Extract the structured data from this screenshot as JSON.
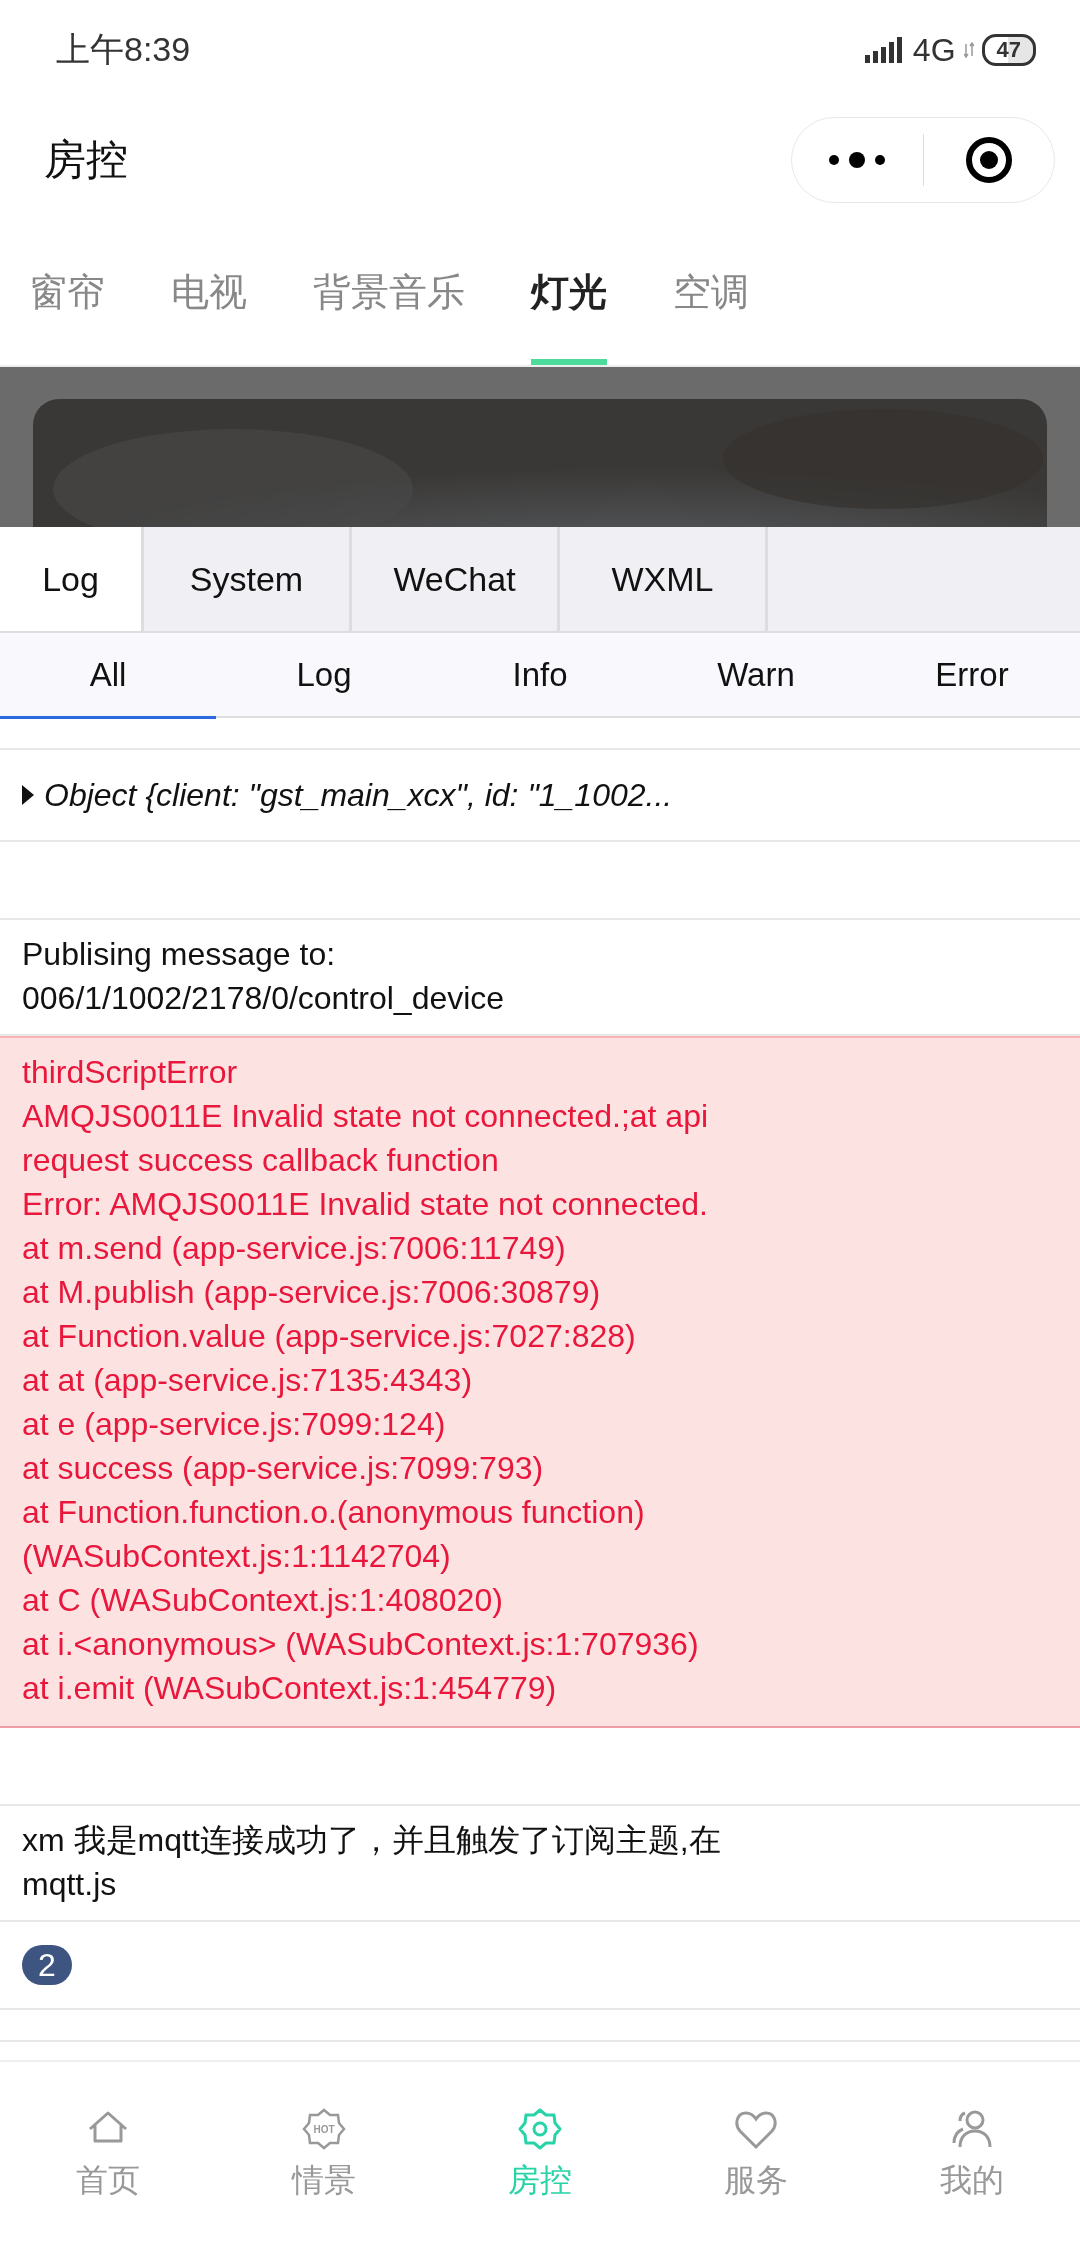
{
  "status_bar": {
    "time": "上午8:39",
    "network": "4G",
    "battery": "47"
  },
  "header": {
    "title": "房控"
  },
  "tabs": [
    {
      "label": "窗帘",
      "selected": false
    },
    {
      "label": "电视",
      "selected": false
    },
    {
      "label": "背景音乐",
      "selected": false
    },
    {
      "label": "灯光",
      "selected": true
    },
    {
      "label": "空调",
      "selected": false
    }
  ],
  "console": {
    "tabs": [
      {
        "label": "Log",
        "selected": true
      },
      {
        "label": "System",
        "selected": false
      },
      {
        "label": "WeChat",
        "selected": false
      },
      {
        "label": "WXML",
        "selected": false
      }
    ],
    "filters": [
      {
        "label": "All",
        "selected": true
      },
      {
        "label": "Log",
        "selected": false
      },
      {
        "label": "Info",
        "selected": false
      },
      {
        "label": "Warn",
        "selected": false
      },
      {
        "label": "Error",
        "selected": false
      }
    ],
    "entries": [
      {
        "kind": "cut"
      },
      {
        "kind": "object",
        "text": "Object {client: \"gst_main_xcx\", id: \"1_1002..."
      },
      {
        "kind": "empty"
      },
      {
        "kind": "log",
        "lines": [
          "Publising message to:",
          "006/1/1002/2178/0/control_device"
        ]
      },
      {
        "kind": "error",
        "lines": [
          "thirdScriptError",
          "AMQJS0011E Invalid state not connected.;at api",
          "request success callback function",
          "Error: AMQJS0011E Invalid state not connected.",
          "at m.send (app-service.js:7006:11749)",
          "at M.publish (app-service.js:7006:30879)",
          "at Function.value (app-service.js:7027:828)",
          "at at (app-service.js:7135:4343)",
          "at e (app-service.js:7099:124)",
          "at success (app-service.js:7099:793)",
          "at Function.function.o.(anonymous function)",
          "(WASubContext.js:1:1142704)",
          "at C (WASubContext.js:1:408020)",
          "at i.<anonymous> (WASubContext.js:1:707936)",
          "at i.emit (WASubContext.js:1:454779)"
        ]
      },
      {
        "kind": "empty"
      },
      {
        "kind": "log",
        "lines": [
          "xm 我是mqtt连接成功了，并且触发了订阅主题,在",
          "mqtt.js"
        ]
      },
      {
        "kind": "count",
        "text": "2"
      },
      {
        "kind": "cut"
      }
    ]
  },
  "nav": [
    {
      "label": "首页",
      "selected": false
    },
    {
      "label": "情景",
      "selected": false,
      "icon_text": "HOT"
    },
    {
      "label": "房控",
      "selected": true
    },
    {
      "label": "服务",
      "selected": false
    },
    {
      "label": "我的",
      "selected": false
    }
  ]
}
